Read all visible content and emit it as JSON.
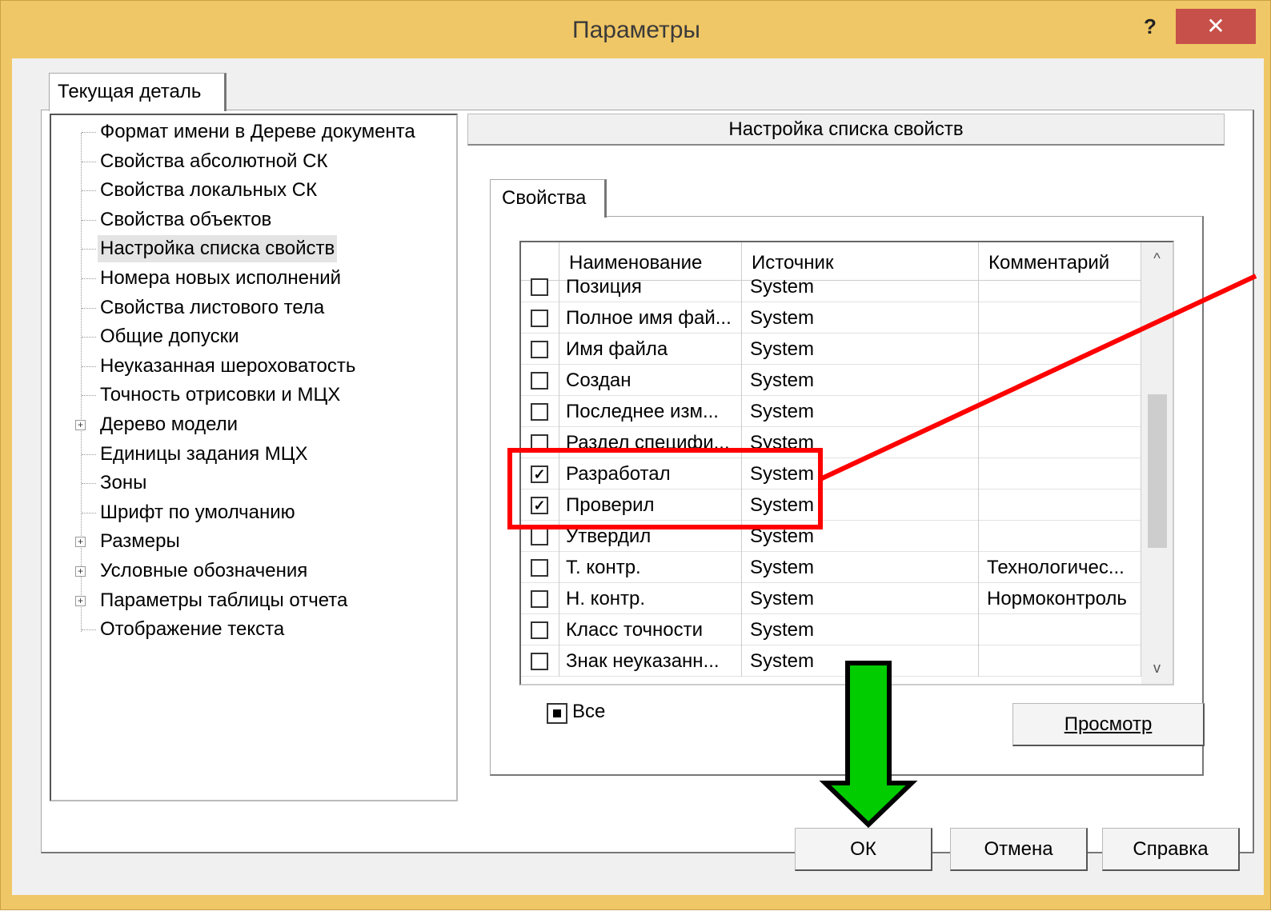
{
  "window": {
    "title": "Параметры",
    "help_label": "?",
    "close_label": "✕"
  },
  "outer_tab": {
    "label": "Текущая деталь"
  },
  "tree": {
    "items": [
      {
        "label": "Формат имени в Дереве документа",
        "expandable": false
      },
      {
        "label": "Свойства абсолютной СК",
        "expandable": false
      },
      {
        "label": "Свойства локальных СК",
        "expandable": false
      },
      {
        "label": "Свойства объектов",
        "expandable": false
      },
      {
        "label": "Настройка списка свойств",
        "expandable": false,
        "selected": true
      },
      {
        "label": "Номера новых исполнений",
        "expandable": false
      },
      {
        "label": "Свойства листового тела",
        "expandable": false
      },
      {
        "label": "Общие допуски",
        "expandable": false
      },
      {
        "label": "Неуказанная шероховатость",
        "expandable": false
      },
      {
        "label": "Точность отрисовки и МЦХ",
        "expandable": false
      },
      {
        "label": "Дерево модели",
        "expandable": true
      },
      {
        "label": "Единицы задания МЦХ",
        "expandable": false
      },
      {
        "label": "Зоны",
        "expandable": false
      },
      {
        "label": "Шрифт по умолчанию",
        "expandable": false
      },
      {
        "label": "Размеры",
        "expandable": true
      },
      {
        "label": "Условные обозначения",
        "expandable": true
      },
      {
        "label": "Параметры таблицы отчета",
        "expandable": true
      },
      {
        "label": "Отображение текста",
        "expandable": false
      }
    ],
    "expand_glyph": "+"
  },
  "section": {
    "title": "Настройка списка свойств"
  },
  "inner_tab": {
    "label": "Свойства"
  },
  "grid": {
    "columns": [
      "Наименование",
      "Источник",
      "Комментарий"
    ],
    "rows": [
      {
        "name": "Позиция",
        "source": "System",
        "comment": "",
        "checked": false
      },
      {
        "name": "Полное имя фай...",
        "source": "System",
        "comment": "",
        "checked": false
      },
      {
        "name": "Имя файла",
        "source": "System",
        "comment": "",
        "checked": false
      },
      {
        "name": "Создан",
        "source": "System",
        "comment": "",
        "checked": false
      },
      {
        "name": "Последнее изм...",
        "source": "System",
        "comment": "",
        "checked": false
      },
      {
        "name": "Раздел специфи...",
        "source": "System",
        "comment": "",
        "checked": false
      },
      {
        "name": "Разработал",
        "source": "System",
        "comment": "",
        "checked": true
      },
      {
        "name": "Проверил",
        "source": "System",
        "comment": "",
        "checked": true
      },
      {
        "name": "Утвердил",
        "source": "System",
        "comment": "",
        "checked": false
      },
      {
        "name": "Т. контр.",
        "source": "System",
        "comment": "Технологичес...",
        "checked": false
      },
      {
        "name": "Н. контр.",
        "source": "System",
        "comment": "Нормоконтроль",
        "checked": false
      },
      {
        "name": "Класс точности",
        "source": "System",
        "comment": "",
        "checked": false
      },
      {
        "name": "Знак неуказанн...",
        "source": "System",
        "comment": "",
        "checked": false
      }
    ],
    "check_glyph": "✓",
    "scroll_up_glyph": "^",
    "scroll_down_glyph": "v"
  },
  "all_toggle": {
    "label": "Все"
  },
  "buttons": {
    "preview": "Просмотр",
    "ok": "ОК",
    "cancel": "Отмена",
    "help": "Справка"
  },
  "annotation_colors": {
    "highlight": "#ff0000",
    "arrow_fill": "#00cc00",
    "arrow_stroke": "#000000"
  }
}
